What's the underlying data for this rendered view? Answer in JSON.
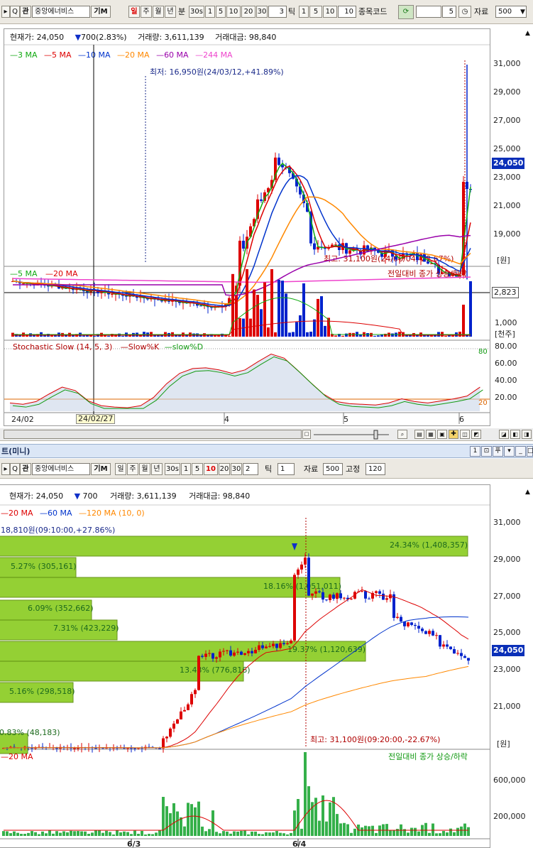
{
  "top": {
    "toolbar": {
      "search_glyph": "Q",
      "corner_label": "관",
      "stock_name": "중앙에너비스",
      "mode_label": "기M",
      "period_buttons": [
        "일",
        "주",
        "월",
        "년",
        "분",
        "30s",
        "1",
        "5",
        "10",
        "20",
        "30"
      ],
      "min_value": "3",
      "tick_label": "틱",
      "tick_buttons": [
        "1",
        "5",
        "10"
      ],
      "tick_value": "10",
      "code_label": "종목코드",
      "code_value": "5",
      "data_label": "자료",
      "data_value": "500"
    },
    "info": {
      "price_label": "현재가:",
      "price": "24,050",
      "change": "700(2.83%)",
      "volume_label": "거래량:",
      "volume": "3,611,139",
      "amount_label": "거래대금:",
      "amount": "98,840"
    },
    "ma_legend": [
      "3 MA",
      "5 MA",
      "10 MA",
      "20 MA",
      "60 MA",
      "244 MA"
    ],
    "low_annotation": "최저: 16,950원(24/03/12,+41.89%)",
    "high_annotation": "최고: 31,100원(24/06/04,-22.67%)",
    "price_axis": [
      "31,000",
      "29,000",
      "27,000",
      "25,000",
      "23,000",
      "21,000",
      "19,000"
    ],
    "price_unit": "[원]",
    "current_price_tag": "24,050",
    "volume_legend": [
      "5 MA",
      "20 MA"
    ],
    "volume_note": "전일대비 종가 상승/하락",
    "volume_axis": [
      "1,000"
    ],
    "volume_tag": "2,823",
    "volume_unit": "[천주]",
    "stoch_legend": "Stochastic Slow (14, 5, 3)",
    "stoch_k": "Slow%K",
    "stoch_d": "slow%D",
    "stoch_axis": [
      "80.00",
      "60.00",
      "40.00",
      "20.00"
    ],
    "stoch_right": [
      "80",
      "20"
    ],
    "date_axis": [
      "24/02",
      "24/02/27",
      "4",
      "5",
      "6"
    ]
  },
  "mini": {
    "title": "트(미니)",
    "toolbar": {
      "corner_label": "관",
      "stock_name": "중앙에너비스",
      "mode_label": "기M",
      "period_buttons": [
        "일",
        "주",
        "월",
        "년",
        "30s",
        "1",
        "5",
        "10",
        "20",
        "30"
      ],
      "min_value": "2",
      "tick_label": "틱",
      "tick_value": "1",
      "data_label": "자료",
      "data_value": "500",
      "fixed_label": "고정",
      "fixed_value": "120"
    },
    "info": {
      "price_label": "현재가:",
      "price": "24,050",
      "change": "700",
      "volume_label": "거래량:",
      "volume": "3,611,139",
      "amount_label": "거래대금:",
      "amount": "98,840"
    },
    "ma_legend": [
      "20 MA",
      "60 MA",
      "120 MA (10, 0)"
    ],
    "low_annotation": "18,810원(09:10:00,+27.86%)",
    "high_annotation": "최고: 31,100원(09:20:00,-22.67%)",
    "volume_profile": [
      "24.34% (1,408,357)",
      "5.27% (305,161)",
      "18.16% (1,051,011)",
      "6.09% (352,662)",
      "7.31% (423,229)",
      "19.37% (1,120,639)",
      "13.43% (776,816)",
      "5.16% (298,518)",
      "0.83% (48,183)"
    ],
    "price_axis": [
      "31,000",
      "29,000",
      "27,000",
      "25,000",
      "23,000",
      "21,000"
    ],
    "price_unit": "[원]",
    "current_price_tag": "24,050",
    "volume_legend": "20 MA",
    "volume_note": "전일대비 종가 상승/하락",
    "volume_axis": [
      "600,000",
      "200,000"
    ],
    "date_axis": [
      "6/3",
      "6/4"
    ]
  },
  "colors": {
    "up": "#dd0000",
    "down": "#0022cc",
    "ma3": "#11aa11",
    "ma5": "#dd0000",
    "ma10": "#0033cc",
    "ma20": "#ff8800",
    "ma60": "#9900aa",
    "ma244": "#ee44cc",
    "profile": "#8fce2a"
  }
}
